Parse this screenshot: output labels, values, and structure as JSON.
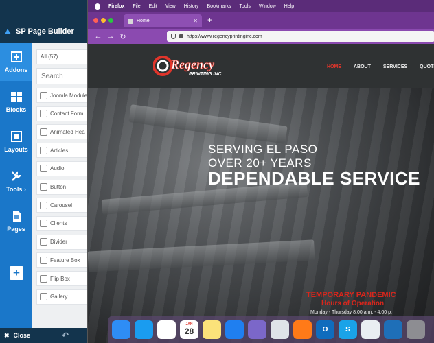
{
  "spb": {
    "title": "SP Page Builder",
    "rail": [
      {
        "id": "addons",
        "label": "Addons",
        "icon": "add-box-icon",
        "active": true
      },
      {
        "id": "blocks",
        "label": "Blocks",
        "icon": "blocks-icon",
        "active": false
      },
      {
        "id": "layouts",
        "label": "Layouts",
        "icon": "layouts-icon",
        "active": false
      },
      {
        "id": "tools",
        "label": "Tools ›",
        "icon": "wrench-icon",
        "active": false
      },
      {
        "id": "pages",
        "label": "Pages",
        "icon": "page-icon",
        "active": false
      }
    ],
    "add_button": "+",
    "filter_label": "All (57)",
    "search_placeholder": "Search",
    "addons": [
      "Joomla Module",
      "Contact Form",
      "Animated Hea",
      "Articles",
      "Audio",
      "Button",
      "Carousel",
      "Clients",
      "Divider",
      "Feature Box",
      "Flip Box",
      "Gallery"
    ],
    "footer": {
      "close_label": "Close",
      "undo_icon": "undo-icon"
    },
    "colors": {
      "header": "#13344d",
      "rail": "#1a77c9",
      "panel": "#eef0f2"
    }
  },
  "menubar": {
    "app": "Firefox",
    "items": [
      "File",
      "Edit",
      "View",
      "History",
      "Bookmarks",
      "Tools",
      "Window",
      "Help"
    ]
  },
  "browser": {
    "tab_title": "Home",
    "new_tab": "+",
    "url": "https://www.regencyprintinginc.com",
    "accent": "#8b4ab0"
  },
  "site": {
    "logo": {
      "main": "Regency",
      "sub": "PRINTING INC."
    },
    "nav": [
      {
        "label": "HOME",
        "active": true
      },
      {
        "label": "ABOUT",
        "active": false
      },
      {
        "label": "SERVICES",
        "active": false
      },
      {
        "label": "QUOTE R",
        "active": false
      }
    ],
    "hero": {
      "line1": "SERVING EL PASO",
      "line2": "OVER 20+ YEARS",
      "line3": "DEPENDABLE SERVICE"
    },
    "notice": {
      "title": "TEMPORARY PANDEMIC",
      "subtitle": "Hours of Operation",
      "hours": "Monday - Thursday 8:00 a.m. - 4:00 p."
    },
    "colors": {
      "red": "#e0352b",
      "header": "#2f3233"
    }
  },
  "dock": [
    {
      "name": "finder-icon",
      "color": "#2e8df5",
      "text": ""
    },
    {
      "name": "safari-icon",
      "color": "#1a9cf0",
      "text": ""
    },
    {
      "name": "chrome-icon",
      "color": "#ffffff",
      "text": ""
    },
    {
      "name": "calendar-icon",
      "color": "#ffffff",
      "text": "28",
      "label": "JAN"
    },
    {
      "name": "notes-icon",
      "color": "#fbe27a",
      "text": ""
    },
    {
      "name": "pin-icon",
      "color": "#1f7ff0",
      "text": ""
    },
    {
      "name": "stack-icon",
      "color": "#7b67c9",
      "text": ""
    },
    {
      "name": "elephant-icon",
      "color": "#dfe3e8",
      "text": ""
    },
    {
      "name": "firefox-icon",
      "color": "#ff7a18",
      "text": ""
    },
    {
      "name": "outlook-icon",
      "color": "#0f6cbd",
      "text": "O"
    },
    {
      "name": "skype-icon",
      "color": "#1aa3e8",
      "text": "S"
    },
    {
      "name": "window-icon",
      "color": "#e9eef2",
      "text": ""
    },
    {
      "name": "vscode-icon",
      "color": "#1e6fb8",
      "text": ""
    },
    {
      "name": "settings-icon",
      "color": "#8d8d92",
      "text": ""
    }
  ]
}
